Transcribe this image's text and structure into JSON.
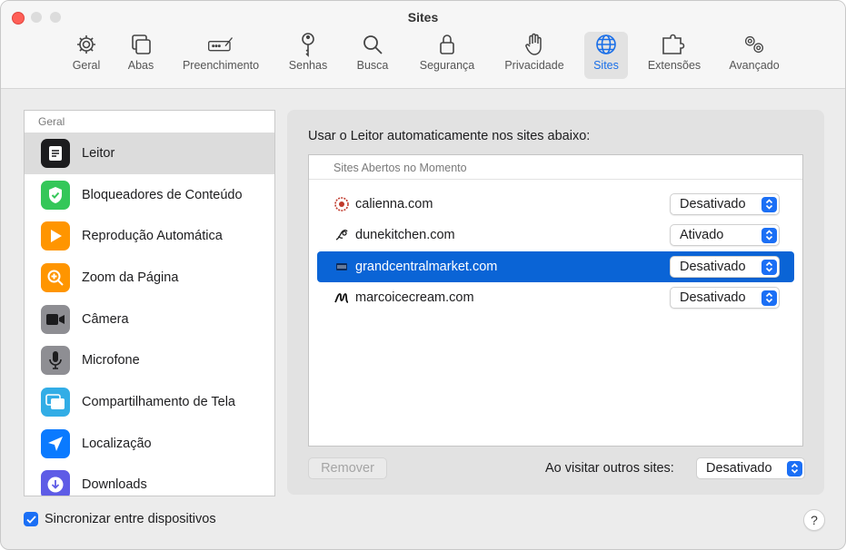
{
  "window": {
    "title": "Sites"
  },
  "toolbar": {
    "tabs": [
      {
        "label": "Geral",
        "icon": "gear-icon"
      },
      {
        "label": "Abas",
        "icon": "tabs-icon"
      },
      {
        "label": "Preenchimento",
        "icon": "autofill-icon"
      },
      {
        "label": "Senhas",
        "icon": "key-icon"
      },
      {
        "label": "Busca",
        "icon": "search-icon"
      },
      {
        "label": "Segurança",
        "icon": "lock-icon"
      },
      {
        "label": "Privacidade",
        "icon": "hand-icon"
      },
      {
        "label": "Sites",
        "icon": "globe-icon",
        "active": true
      },
      {
        "label": "Extensões",
        "icon": "puzzle-icon"
      },
      {
        "label": "Avançado",
        "icon": "gears-icon"
      }
    ]
  },
  "sidebar": {
    "section": "Geral",
    "items": [
      {
        "label": "Leitor",
        "icon": "reader-icon",
        "color": "#1c1c1e",
        "selected": true
      },
      {
        "label": "Bloqueadores de Conteúdo",
        "icon": "shield-check-icon",
        "color": "#34c759"
      },
      {
        "label": "Reprodução Automática",
        "icon": "play-icon",
        "color": "#ff9500"
      },
      {
        "label": "Zoom da Página",
        "icon": "zoom-icon",
        "color": "#ff9500"
      },
      {
        "label": "Câmera",
        "icon": "camera-icon",
        "color": "#8e8e93"
      },
      {
        "label": "Microfone",
        "icon": "microphone-icon",
        "color": "#8e8e93"
      },
      {
        "label": "Compartilhamento de Tela",
        "icon": "screen-share-icon",
        "color": "#32ade6"
      },
      {
        "label": "Localização",
        "icon": "location-arrow-icon",
        "color": "#0a7aff"
      },
      {
        "label": "Downloads",
        "icon": "download-icon",
        "color": "#5e5ce6"
      }
    ]
  },
  "main": {
    "title": "Usar o Leitor automaticamente nos sites abaixo:",
    "list_header": "Sites Abertos no Momento",
    "sites": [
      {
        "domain": "calienna.com",
        "setting": "Desativado",
        "favicon": "calienna-favicon"
      },
      {
        "domain": "dunekitchen.com",
        "setting": "Ativado",
        "favicon": "dunekitchen-favicon"
      },
      {
        "domain": "grandcentralmarket.com",
        "setting": "Desativado",
        "favicon": "grandcentralmarket-favicon",
        "selected": true
      },
      {
        "domain": "marcoicecream.com",
        "setting": "Desativado",
        "favicon": "marcoicecream-favicon"
      }
    ],
    "remove_label": "Remover",
    "other_sites_label": "Ao visitar outros sites:",
    "other_sites_value": "Desativado"
  },
  "footer": {
    "sync_label": "Sincronizar entre dispositivos",
    "sync_checked": true,
    "help_label": "?"
  },
  "colors": {
    "accent": "#1b6ff5",
    "selection": "#0a64d6"
  }
}
